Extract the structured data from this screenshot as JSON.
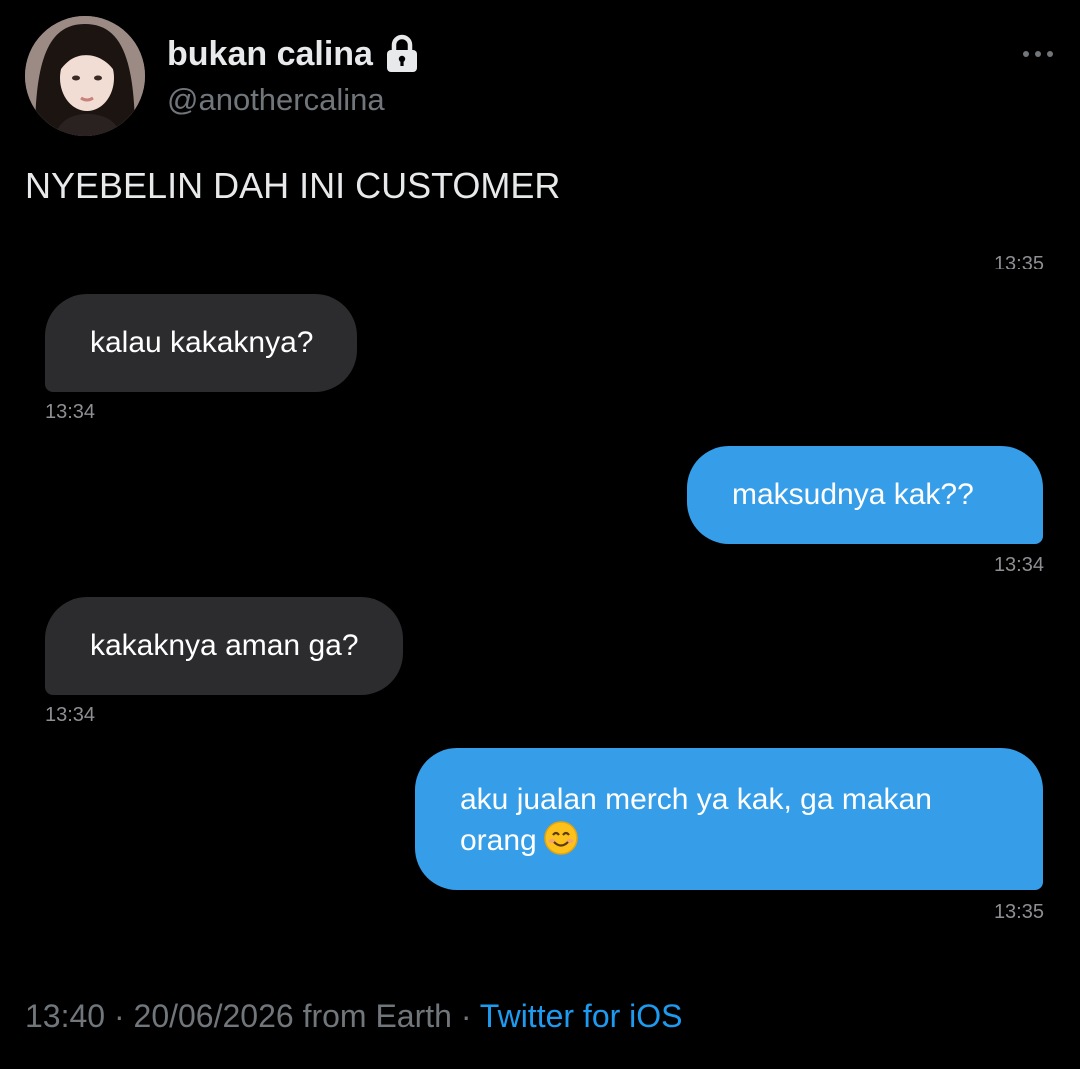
{
  "tweet": {
    "author": {
      "display_name": "bukan calina",
      "handle": "@anothercalina",
      "protected_icon": "lock-icon"
    },
    "more_icon": "more-horizontal-icon",
    "text": "NYEBELIN DAH INI CUSTOMER",
    "meta": {
      "time": "13:40",
      "separator": " · ",
      "date": "20/06/2026",
      "location": " from Earth",
      "source": "Twitter for iOS"
    }
  },
  "chat": {
    "clipped_timestamp": "13:35",
    "messages": [
      {
        "direction": "incoming",
        "text": "kalau kakaknya?",
        "time": "13:34"
      },
      {
        "direction": "outgoing",
        "text": "maksudnya kak??",
        "time": "13:34"
      },
      {
        "direction": "incoming",
        "text": "kakaknya aman ga?",
        "time": "13:34"
      },
      {
        "direction": "outgoing",
        "text_line1": "aku jualan merch ya kak, ga makan",
        "text_line2": "orang",
        "emoji": "smiling-face-icon",
        "time": "13:35"
      }
    ]
  },
  "colors": {
    "background": "#000000",
    "incoming_bubble": "#2c2c2e",
    "outgoing_bubble": "#369ee8",
    "link": "#1d9bf0",
    "secondary_text": "#71767b"
  }
}
